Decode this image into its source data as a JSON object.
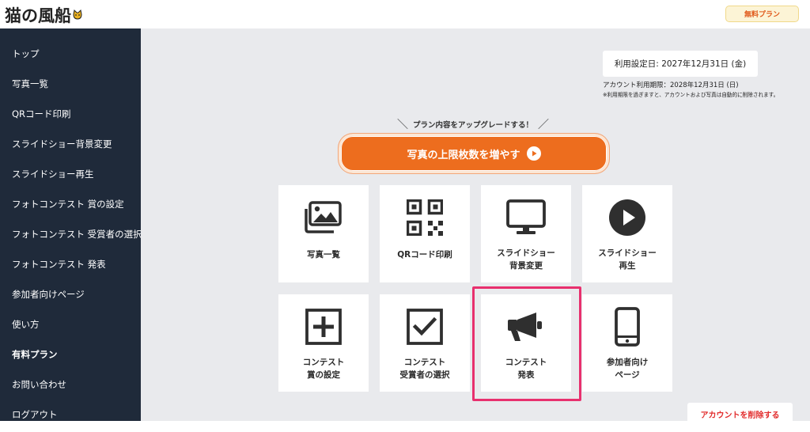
{
  "header": {
    "logo": "猫の風船",
    "plan_badge": "無料プラン"
  },
  "sidebar": {
    "items": [
      {
        "label": "トップ"
      },
      {
        "label": "写真一覧"
      },
      {
        "label": "QRコード印刷"
      },
      {
        "label": "スライドショー背景変更"
      },
      {
        "label": "スライドショー再生"
      },
      {
        "label": "フォトコンテスト 賞の設定"
      },
      {
        "label": "フォトコンテスト 受賞者の選択"
      },
      {
        "label": "フォトコンテスト 発表"
      },
      {
        "label": "参加者向けページ"
      },
      {
        "label": "使い方"
      },
      {
        "label": "有料プラン",
        "active": true
      },
      {
        "label": "お問い合わせ"
      },
      {
        "label": "ログアウト"
      }
    ]
  },
  "account": {
    "date_setting": "利用設定日: 2027年12月31日 (金)",
    "expiry": "アカウント利用期限：2028年12月31日 (日)",
    "note": "※利用期限を過ぎますと、アカウントおよび写真は自動的に削除されます。"
  },
  "upgrade": {
    "lead": "プラン内容をアップグレードする！",
    "button": "写真の上限枚数を増やす"
  },
  "tiles": [
    {
      "line1": "写真一覧",
      "line2": "",
      "icon": "photo-gallery-icon"
    },
    {
      "line1": "QRコード印刷",
      "line2": "",
      "icon": "qr-code-icon"
    },
    {
      "line1": "スライドショー",
      "line2": "背景変更",
      "icon": "monitor-icon"
    },
    {
      "line1": "スライドショー",
      "line2": "再生",
      "icon": "play-circle-icon"
    },
    {
      "line1": "コンテスト",
      "line2": "賞の設定",
      "icon": "plus-square-icon"
    },
    {
      "line1": "コンテスト",
      "line2": "受賞者の選択",
      "icon": "check-square-icon"
    },
    {
      "line1": "コンテスト",
      "line2": "発表",
      "icon": "megaphone-icon"
    },
    {
      "line1": "参加者向け",
      "line2": "ページ",
      "icon": "smartphone-icon"
    }
  ],
  "delete_account": "アカウントを削除する",
  "colors": {
    "sidebar_bg": "#1f2a3a",
    "accent_orange": "#ed6d1e",
    "highlight_pink": "#e8306e",
    "delete_red": "#e22d2d"
  }
}
